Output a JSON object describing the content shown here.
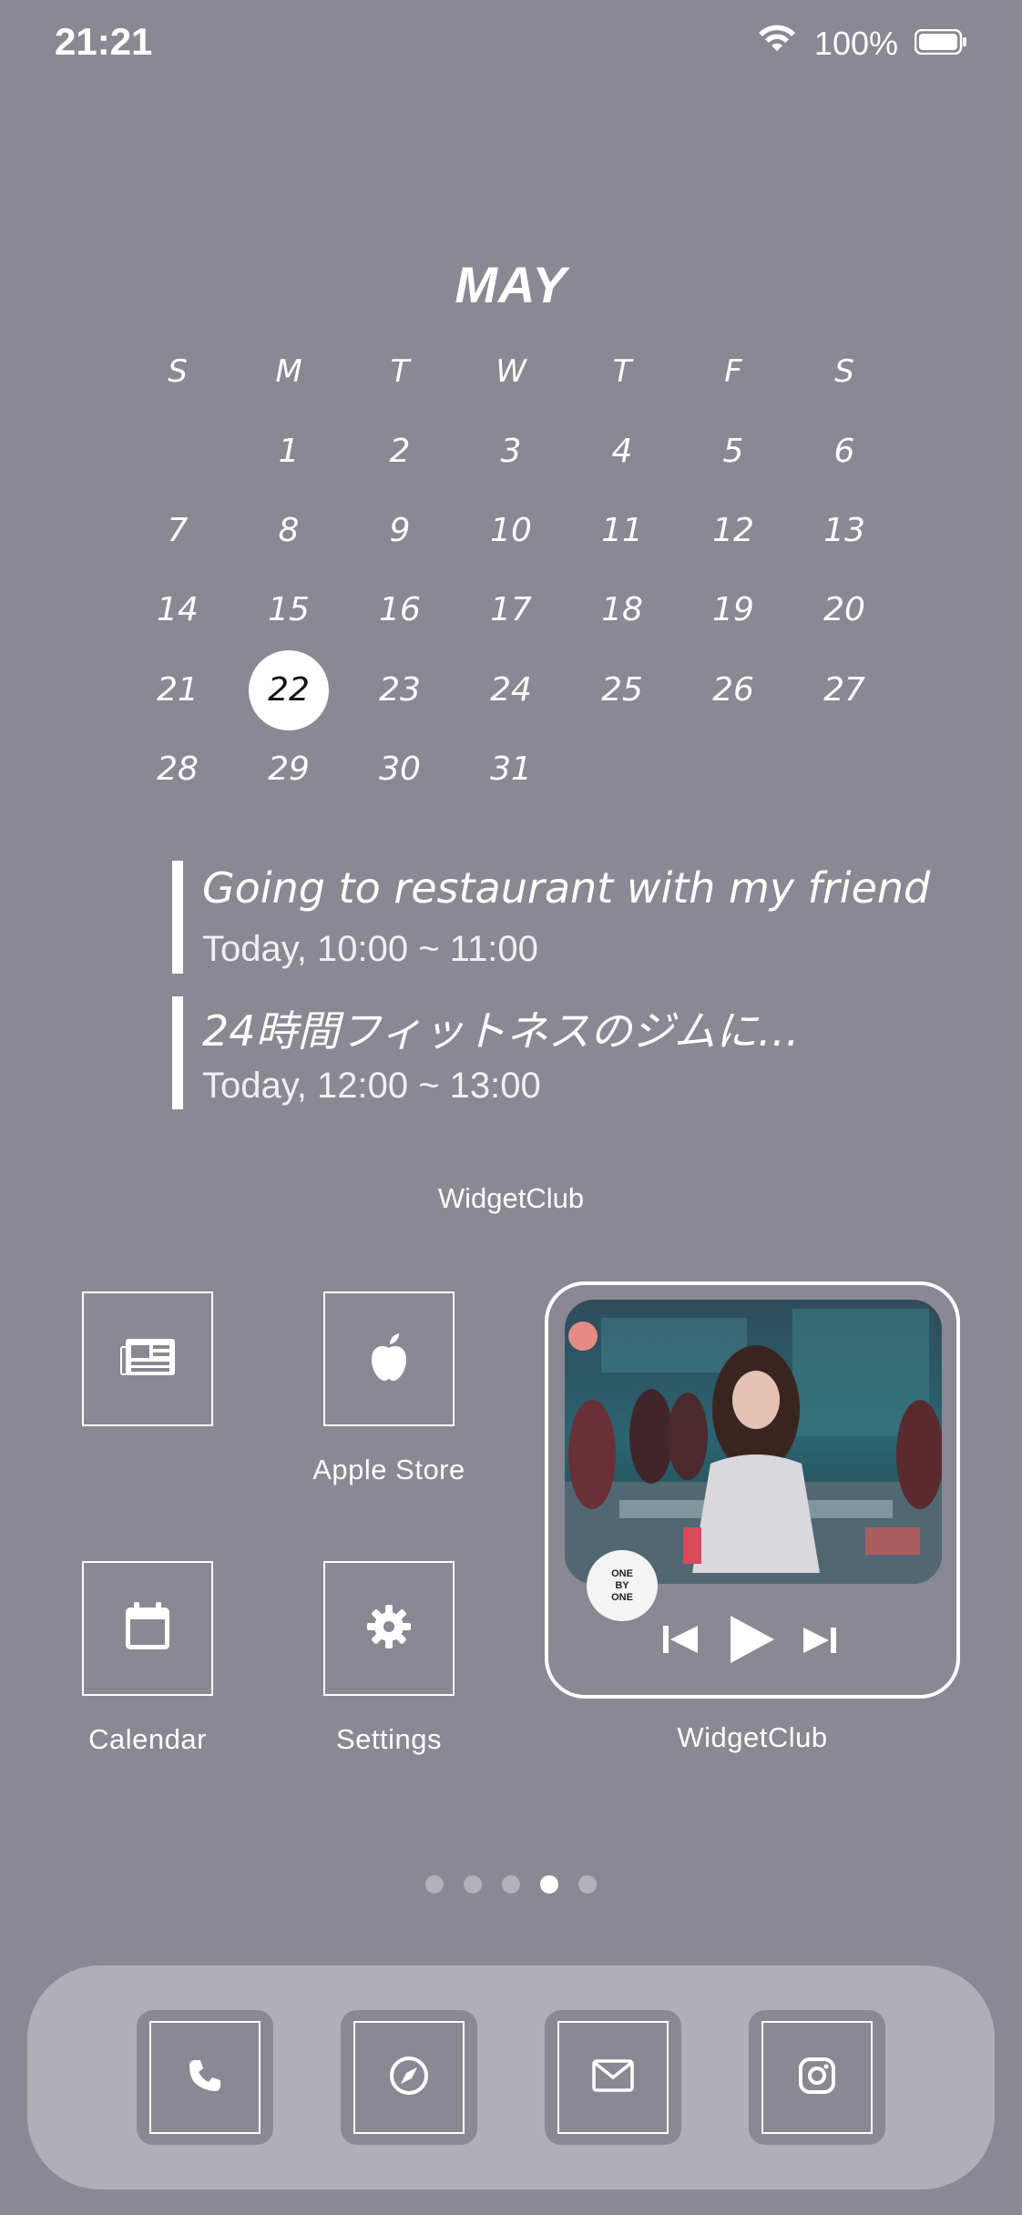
{
  "status_bar": {
    "time": "21:21",
    "battery": "100%"
  },
  "calendar": {
    "month": "MAY",
    "weekdays": [
      "S",
      "M",
      "T",
      "W",
      "T",
      "F",
      "S"
    ],
    "weeks": [
      [
        "",
        "1",
        "2",
        "3",
        "4",
        "5",
        "6"
      ],
      [
        "7",
        "8",
        "9",
        "10",
        "11",
        "12",
        "13"
      ],
      [
        "14",
        "15",
        "16",
        "17",
        "18",
        "19",
        "20"
      ],
      [
        "21",
        "22",
        "23",
        "24",
        "25",
        "26",
        "27"
      ],
      [
        "28",
        "29",
        "30",
        "31",
        "",
        "",
        ""
      ]
    ],
    "today": "22"
  },
  "events": [
    {
      "title": "Going to restaurant with my friend",
      "time": "Today, 10:00 ~ 11:00"
    },
    {
      "title": "24時間フィットネスのジムに…",
      "time": "Today, 12:00 ~ 13:00"
    }
  ],
  "widget_label_top": "WidgetClub",
  "apps": [
    {
      "label": "",
      "icon": "newspaper-icon"
    },
    {
      "label": "Apple Store",
      "icon": "apple-icon"
    },
    {
      "label": "Calendar",
      "icon": "calendar-icon"
    },
    {
      "label": "Settings",
      "icon": "gear-icon"
    }
  ],
  "music_widget": {
    "label": "WidgetClub",
    "badge": "ONE BY ONE"
  },
  "page_dots": {
    "count": 5,
    "active": 4
  },
  "dock": [
    {
      "icon": "phone-icon"
    },
    {
      "icon": "compass-icon"
    },
    {
      "icon": "mail-icon"
    },
    {
      "icon": "instagram-icon"
    }
  ]
}
